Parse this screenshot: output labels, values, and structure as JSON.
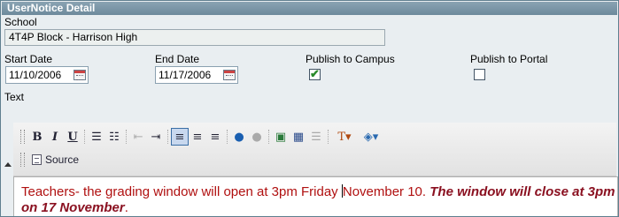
{
  "panel": {
    "title": "UserNotice Detail"
  },
  "school": {
    "label": "School",
    "value": "4T4P Block - Harrison High"
  },
  "start_date": {
    "label": "Start Date",
    "value": "11/10/2006"
  },
  "end_date": {
    "label": "End Date",
    "value": "11/17/2006"
  },
  "publish_campus": {
    "label": "Publish to Campus",
    "checked": true
  },
  "publish_portal": {
    "label": "Publish to Portal",
    "checked": false
  },
  "text_label": "Text",
  "toolbar": {
    "bold": "B",
    "italic": "I",
    "underline": "U",
    "source_label": "Source",
    "icons": [
      "bold-icon",
      "italic-icon",
      "underline-icon",
      "ordered-list-icon",
      "bulleted-list-icon",
      "outdent-icon",
      "indent-icon",
      "align-left-icon",
      "align-center-icon",
      "align-right-icon",
      "link-icon",
      "unlink-icon",
      "image-icon",
      "table-icon",
      "horizontal-rule-icon",
      "text-color-icon",
      "background-color-icon",
      "source-icon"
    ]
  },
  "editor": {
    "text_before_caret": "Teachers-  the grading window will open at 3pm Friday ",
    "text_after_caret": "November 10.  ",
    "emphasis": "The window will close at 3pm on 17 November",
    "text_end": "."
  }
}
